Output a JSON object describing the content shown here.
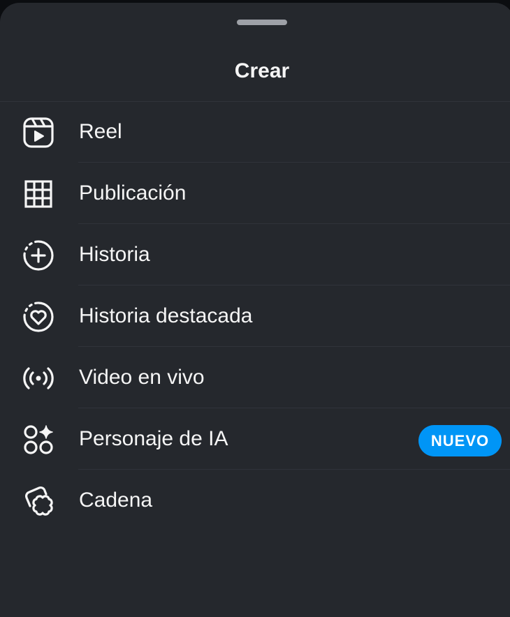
{
  "sheet": {
    "title": "Crear"
  },
  "menu": {
    "items": [
      {
        "label": "Reel",
        "icon": "reels-icon"
      },
      {
        "label": "Publicación",
        "icon": "grid-icon"
      },
      {
        "label": "Historia",
        "icon": "story-add-icon"
      },
      {
        "label": "Historia destacada",
        "icon": "highlight-heart-icon"
      },
      {
        "label": "Video en vivo",
        "icon": "live-broadcast-icon"
      },
      {
        "label": "Personaje de IA",
        "icon": "ai-character-icon",
        "badge": "NUEVO"
      },
      {
        "label": "Cadena",
        "icon": "threads-chain-icon"
      }
    ]
  },
  "colors": {
    "sheet_background": "#25282d",
    "text": "#f5f5f5",
    "separator": "#30333a",
    "badge_background": "#0095f6",
    "grabber": "#9ea1a7"
  }
}
